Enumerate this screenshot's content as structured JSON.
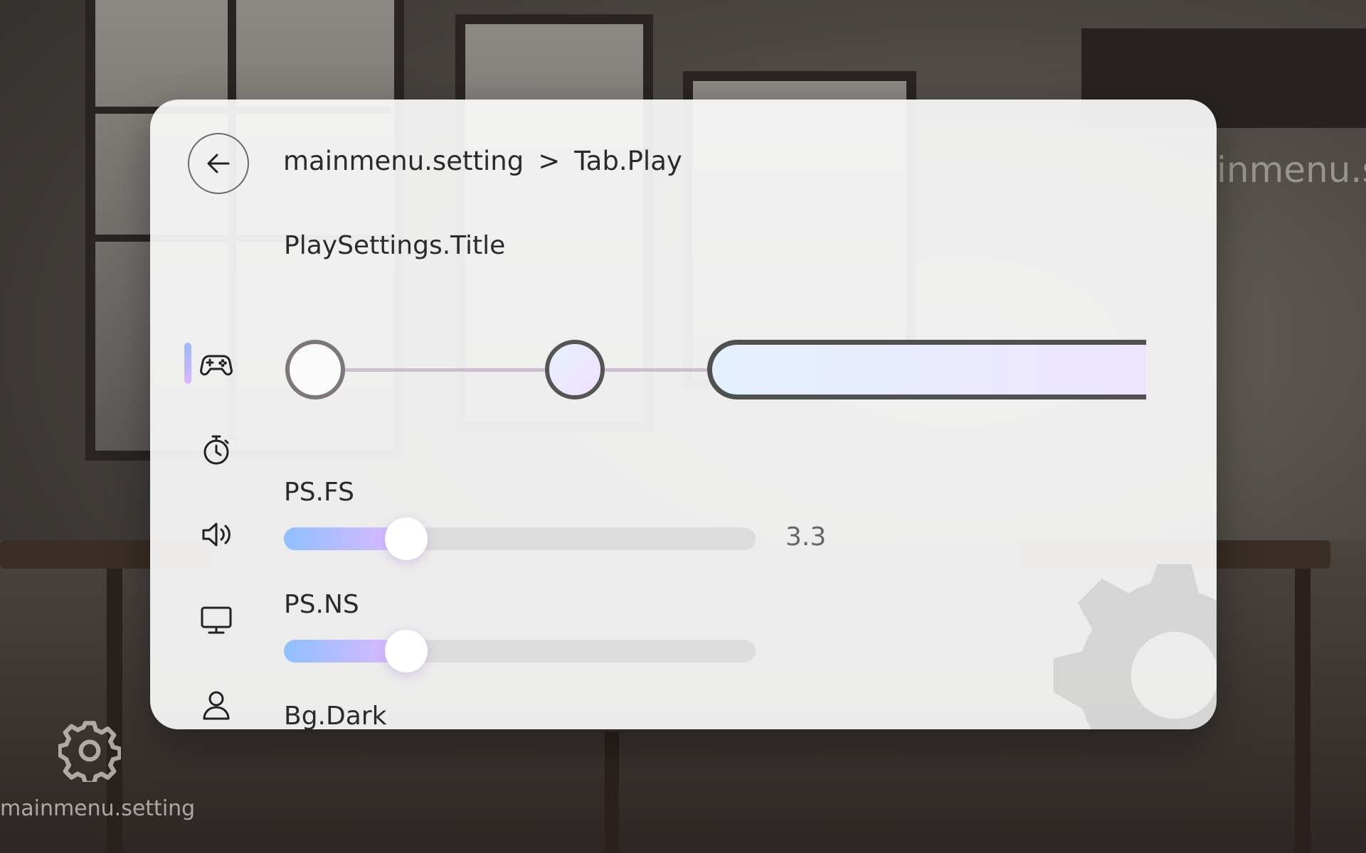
{
  "background": {
    "watermark_text": "inmenu.st"
  },
  "panel": {
    "back_icon": "arrow-left-icon",
    "breadcrumb": {
      "root": "mainmenu.setting",
      "separator": ">",
      "current": "Tab.Play"
    },
    "sidebar": {
      "items": [
        {
          "icon": "gamepad-icon",
          "active": true
        },
        {
          "icon": "stopwatch-icon",
          "active": false
        },
        {
          "icon": "speaker-icon",
          "active": false
        },
        {
          "icon": "monitor-icon",
          "active": false
        },
        {
          "icon": "user-icon",
          "active": false
        }
      ]
    },
    "section_title": "PlaySettings.Title",
    "selector": {
      "options": 3,
      "selected_index": 2
    },
    "sliders": [
      {
        "label": "PS.FS",
        "value": "3.3",
        "fraction": 0.26
      },
      {
        "label": "PS.NS",
        "value": "",
        "fraction": 0.26
      }
    ],
    "next_label": "Bg.Dark"
  },
  "floating_settings": {
    "icon": "gear-icon",
    "label": "mainmenu.setting"
  },
  "colors": {
    "accent_start": "#8fc0ff",
    "accent_end": "#e2b8ff",
    "panel_bg": "#fafafa",
    "text": "#2a2a2a"
  }
}
